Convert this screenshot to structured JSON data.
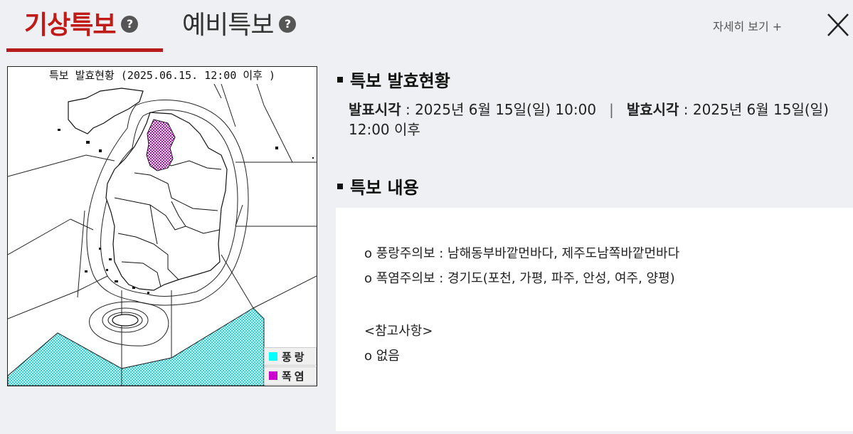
{
  "tabs": [
    {
      "label": "기상특보",
      "help": "?"
    },
    {
      "label": "예비특보",
      "help": "?"
    }
  ],
  "detail_link": "자세히 보기 +",
  "map": {
    "title": "특보 발효현황 (2025.06.15. 12:00 이후 )",
    "legend": [
      {
        "label": "풍랑",
        "color": "#00ffff"
      },
      {
        "label": "폭염",
        "color": "#cc00cc"
      }
    ]
  },
  "status": {
    "heading": "특보 발효현황",
    "announce_label": "발표시각",
    "announce_value": " : 2025년 6월 15일(일) 10:00",
    "separator": "|",
    "effective_label": "발효시각",
    "effective_value": " : 2025년 6월 15일(일) 12:00 이후"
  },
  "content": {
    "heading": "특보 내용",
    "lines": [
      "o 풍랑주의보 : 남해동부바깥먼바다, 제주도남쪽바깥먼바다",
      "o 폭염주의보 : 경기도(포천, 가평, 파주, 안성, 여주, 양평)",
      "<참고사항>",
      "o 없음"
    ]
  },
  "colors": {
    "accent": "#c11b17",
    "sea_warning": "#00ffff",
    "heat_warning": "#cc00cc"
  }
}
